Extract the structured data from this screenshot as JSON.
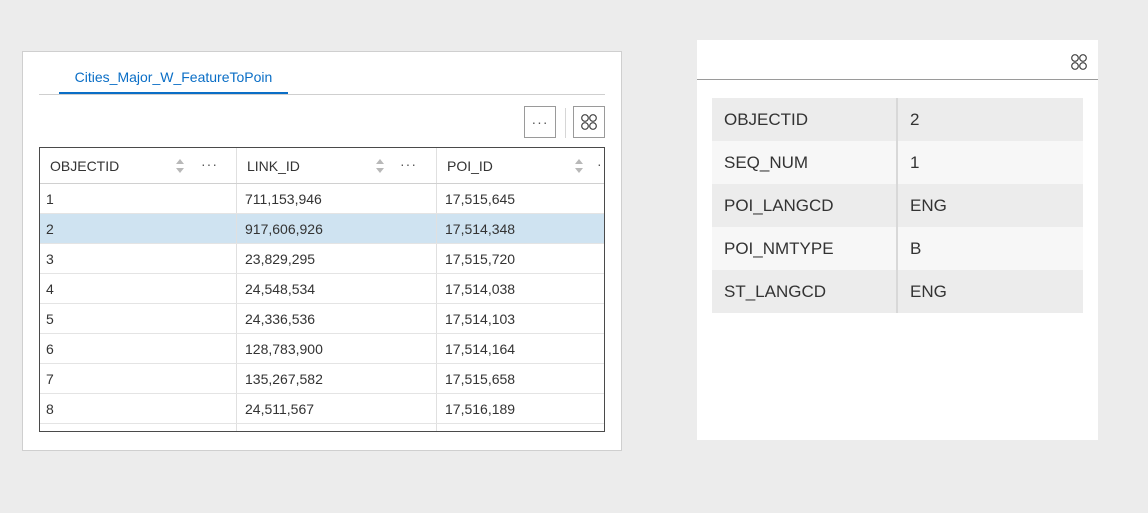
{
  "table_widget": {
    "tab_label": "Cities_Major_W_FeatureToPoin",
    "more_options_label": "···",
    "columns": [
      {
        "label": "OBJECTID"
      },
      {
        "label": "LINK_ID"
      },
      {
        "label": "POI_ID"
      }
    ],
    "rows": [
      {
        "objectid": "1",
        "link_id": "711,153,946",
        "poi_id": "17,515,645"
      },
      {
        "objectid": "2",
        "link_id": "917,606,926",
        "poi_id": "17,514,348"
      },
      {
        "objectid": "3",
        "link_id": "23,829,295",
        "poi_id": "17,515,720"
      },
      {
        "objectid": "4",
        "link_id": "24,548,534",
        "poi_id": "17,514,038"
      },
      {
        "objectid": "5",
        "link_id": "24,336,536",
        "poi_id": "17,514,103"
      },
      {
        "objectid": "6",
        "link_id": "128,783,900",
        "poi_id": "17,514,164"
      },
      {
        "objectid": "7",
        "link_id": "135,267,582",
        "poi_id": "17,515,658"
      },
      {
        "objectid": "8",
        "link_id": "24,511,567",
        "poi_id": "17,516,189"
      }
    ],
    "selected_row_objectid": "2",
    "selection_color": "#cfe3f1",
    "accent_color": "#0a6ec6"
  },
  "feature_info": {
    "attributes": [
      {
        "key": "OBJECTID",
        "value": "2"
      },
      {
        "key": "SEQ_NUM",
        "value": "1"
      },
      {
        "key": "POI_LANGCD",
        "value": "ENG"
      },
      {
        "key": "POI_NMTYPE",
        "value": "B"
      },
      {
        "key": "ST_LANGCD",
        "value": "ENG"
      }
    ]
  },
  "icons": {
    "column_menu": "more-horizontal-icon",
    "sort": "sort-arrows-icon",
    "grid_view": "grid-view-icon"
  }
}
